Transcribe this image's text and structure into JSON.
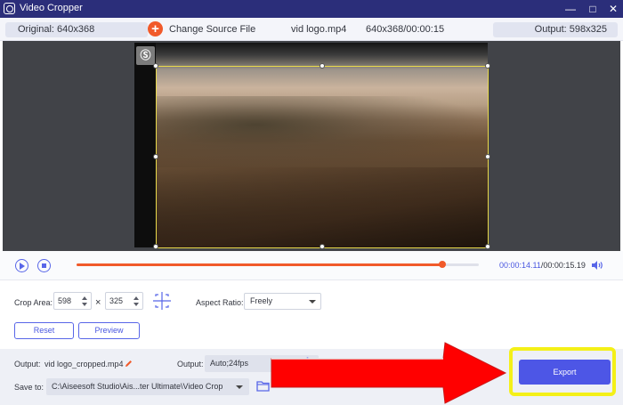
{
  "window": {
    "title": "Video Cropper",
    "icon": "video-cropper-app-icon",
    "controls": {
      "minimize": "—",
      "maximize": "□",
      "close": "✕"
    }
  },
  "infobar": {
    "original": "Original: 640x368",
    "change_source": "Change Source File",
    "add_icon": "+",
    "file_name": "vid logo.mp4",
    "file_info": "640x368/00:00:15",
    "output": "Output: 598x325"
  },
  "preview": {
    "watermark_glyph": "Ⓢ"
  },
  "playback": {
    "progress_fraction": 0.91,
    "current_time": "00:00:14.11",
    "total_time": "/00:00:15.19"
  },
  "crop": {
    "crop_area_label": "Crop Area:",
    "width": "598",
    "times": "×",
    "height": "325",
    "aspect_label": "Aspect Ratio:",
    "aspect_value": "Freely",
    "reset_label": "Reset",
    "preview_label": "Preview"
  },
  "footer": {
    "output_label": "Output:",
    "output_file": "vid logo_cropped.mp4",
    "output_format_label": "Output:",
    "output_format": "Auto;24fps",
    "save_to_label": "Save to:",
    "save_path": "C:\\Aiseesoft Studio\\Ais...ter Ultimate\\Video Crop",
    "export_label": "Export"
  },
  "colors": {
    "titlebar": "#2b2e7a",
    "accent": "#5866e8",
    "progress": "#f15a2a",
    "export": "#4d56e6",
    "highlight": "#f4f018",
    "arrow": "#ff0000"
  }
}
